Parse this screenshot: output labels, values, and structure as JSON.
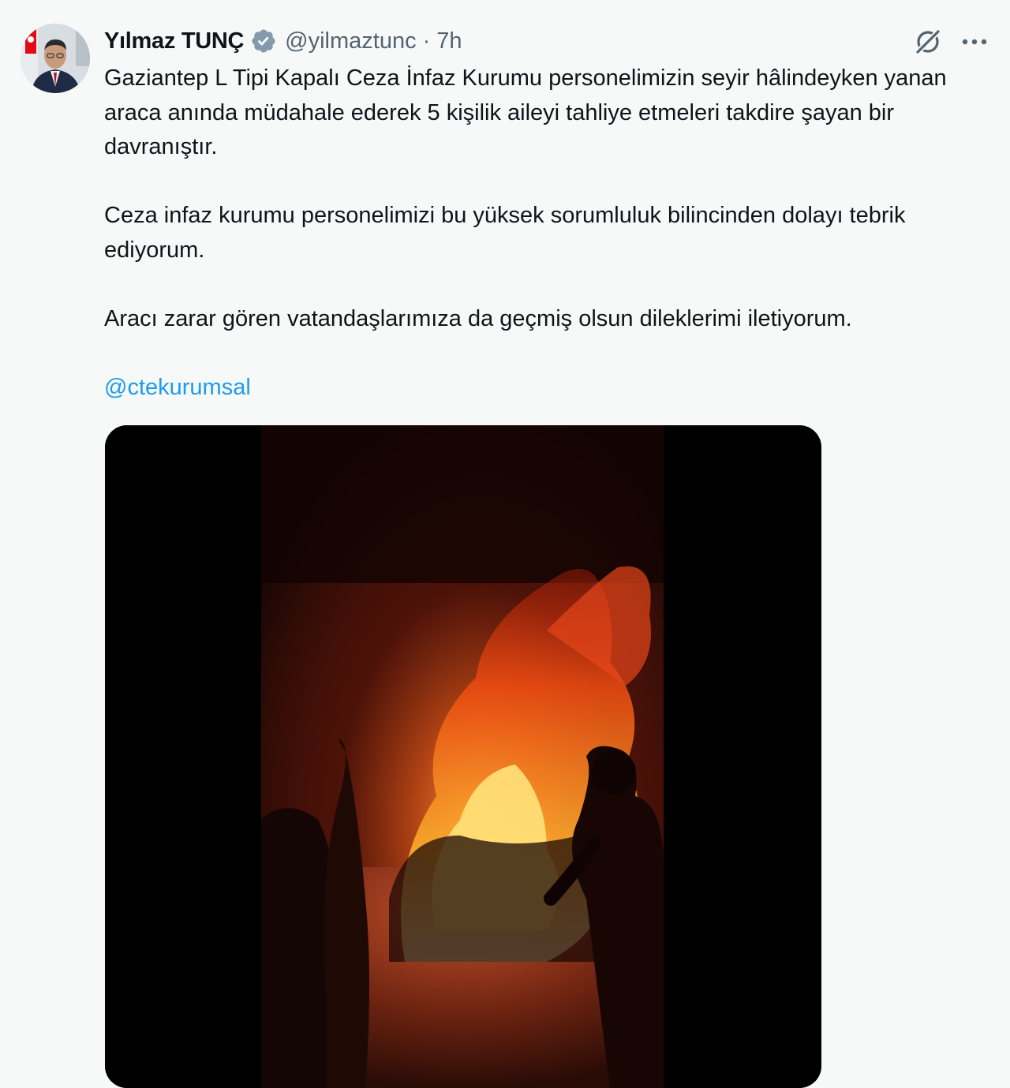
{
  "author": {
    "name": "Yılmaz TUNÇ",
    "handle": "@yilmaztunc",
    "separator": "·",
    "time": "7h"
  },
  "tweet": {
    "paragraphs": [
      "Gaziantep L Tipi Kapalı Ceza İnfaz Kurumu personelimizin seyir hâlindeyken yanan araca anında müdahale ederek 5 kişilik aileyi tahliye etmeleri takdire şayan bir davranıştır.",
      "Ceza infaz kurumu personelimizi bu yüksek sorumluluk bilincinden dolayı tebrik ediyorum.",
      "Aracı zarar gören vatandaşlarımıza da geçmiş olsun dileklerimi iletiyorum."
    ],
    "mention": "@ctekurumsal"
  },
  "icons": {
    "verified": "verified-badge-icon",
    "grok": "grok-icon",
    "more": "more-options-icon"
  },
  "colors": {
    "background": "#f7f9f9",
    "text": "#0f1419",
    "secondary": "#536471",
    "accent": "#1d9bf0"
  }
}
